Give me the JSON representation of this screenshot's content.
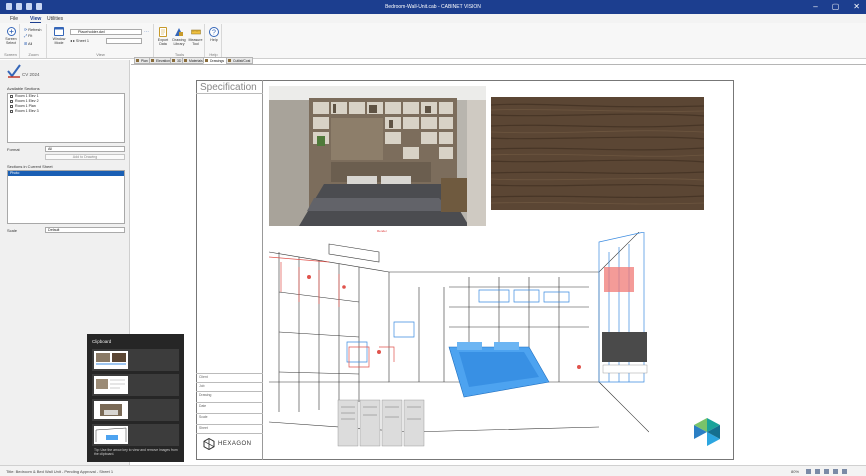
{
  "window": {
    "title": "Bedroom-Wall-Unit.cab - CABINET VISION",
    "buttons": [
      "–",
      "▢",
      "✕"
    ]
  },
  "ribbon_tabs": [
    "File",
    "View",
    "Utilities"
  ],
  "ribbon": {
    "screen_group": {
      "label": "Screen",
      "buttons": [
        "Screen Select",
        "Refresh",
        "Fit",
        "All"
      ]
    },
    "zoom_group": {
      "label": "Zoom"
    },
    "view_group": {
      "label": "View",
      "window_mode": "Window Mode",
      "dimension_combo": "Placeholder.dwl",
      "sheet_combo": "Sheet 1",
      "sheet_label": "Sheet"
    },
    "tools_group": {
      "label": "Tools",
      "buttons": [
        "Export Data",
        "Drawing Library",
        "Measure Tool"
      ]
    },
    "help_group": {
      "label": "Help",
      "buttons": [
        "Help"
      ]
    }
  },
  "left_panel": {
    "title": "CV 2024",
    "available_sections_label": "Available Sections",
    "available_sections": [
      "Room 1 Elev 1",
      "Room 1 Elev 2",
      "Room 1 Plan",
      "Room 1 Elev 3"
    ],
    "filter_label": "Format",
    "filter_value": "All",
    "add_button": "Add to Drawing",
    "sections_in_sheet_label": "Sections in Current Sheet",
    "sections_in_sheet": [
      "Photo"
    ],
    "scale_label": "Scale",
    "scale_value": "Default"
  },
  "doc_tabs": [
    "Plan",
    "Elevation",
    "3D",
    "Materials",
    "Drawings",
    "Cutlist/Cost"
  ],
  "drawing_sheet": {
    "title": "Specification",
    "caption": "Render",
    "titleblock_fields": [
      "Client",
      "Job",
      "Drawing",
      "Date",
      "Scale",
      "Sheet"
    ],
    "logo_text": "HEXAGON"
  },
  "clipboard": {
    "title": "Clipboard",
    "note": "Tip: Use the arrow key to view and remove images from the clipboard."
  },
  "statusbar": {
    "text": "Title: Bedroom & Bed Wall Unit - Pending Approval - Sheet 1",
    "zoom": "80%"
  },
  "colors": {
    "titlebar": "#1c3e8f",
    "accent": "#1a5fb4",
    "wireframe_blue": "#3b8be0",
    "wireframe_red": "#e0534c"
  }
}
